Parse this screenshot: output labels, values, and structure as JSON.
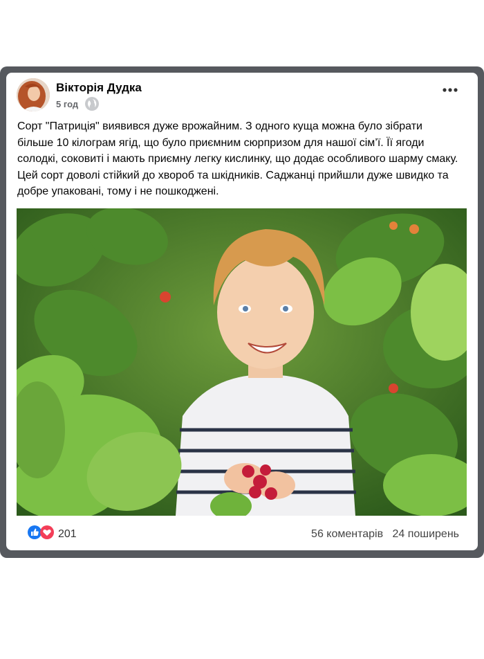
{
  "post": {
    "author": "Вікторія Дудка",
    "time": "5 год",
    "text": "Сорт \"Патриція\" виявився дуже врожайним. З одного куща можна було зібрати більше 10 кілограм ягід, що було приємним сюрпризом для нашої сім’ї. Її ягоди солодкі, соковиті і мають приємну легку кислинку, що додає особливого шарму смаку. Цей сорт доволі стійкий до хвороб та шкідників. Саджанці прийшли дуже швидко та добре упаковані, тому і не пошкоджені.",
    "reactions_count": "201",
    "comments": "56 коментарів",
    "shares": "24 поширень",
    "icons": {
      "like": "like-icon",
      "love": "love-icon",
      "privacy": "globe-icon",
      "menu": "more-options-icon"
    },
    "colors": {
      "frame": "#56595e",
      "like_blue": "#1877f2",
      "love_red": "#f33e58"
    }
  }
}
